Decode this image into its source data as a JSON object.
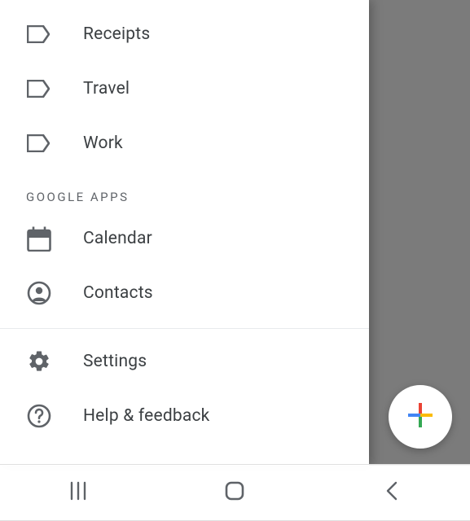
{
  "drawer": {
    "labels": [
      {
        "label": "Receipts"
      },
      {
        "label": "Travel"
      },
      {
        "label": "Work"
      }
    ],
    "section_header": "GOOGLE APPS",
    "apps": [
      {
        "label": "Calendar"
      },
      {
        "label": "Contacts"
      }
    ],
    "settings_label": "Settings",
    "help_label": "Help & feedback"
  },
  "colors": {
    "icon": "#5f6368",
    "text": "#3c4043"
  }
}
